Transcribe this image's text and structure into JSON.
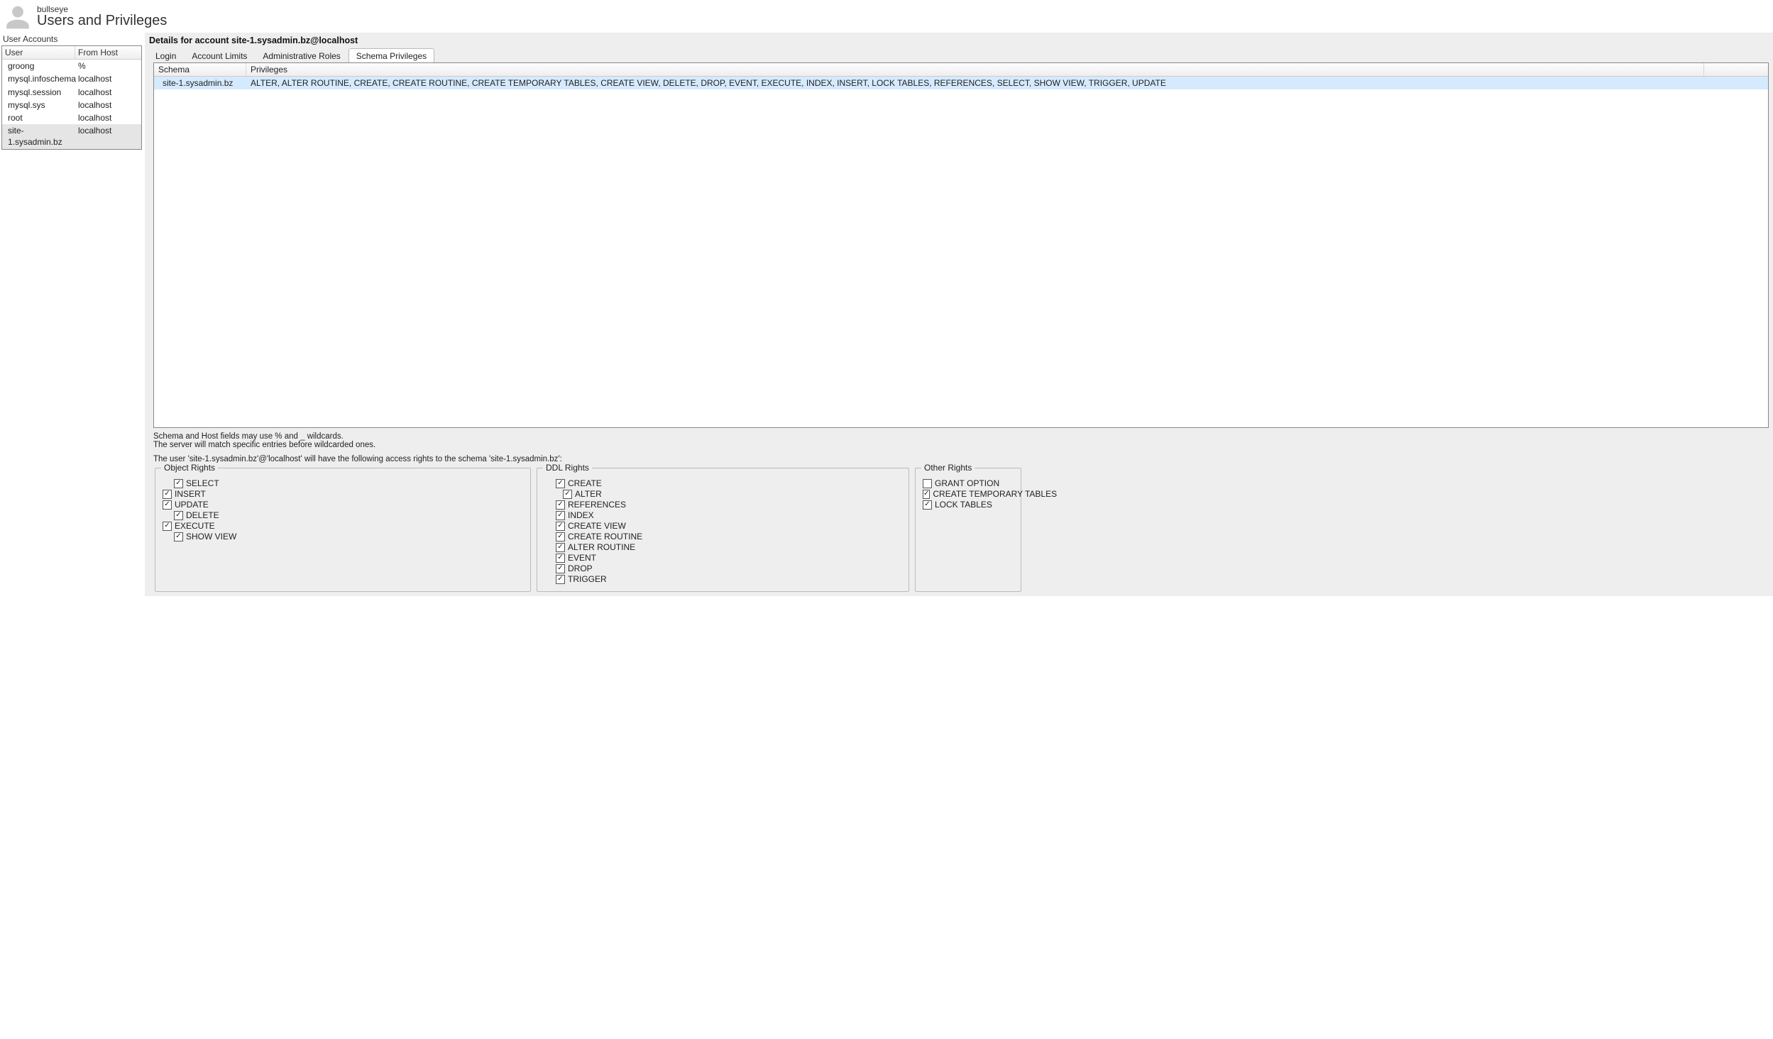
{
  "header": {
    "subtitle": "bullseye",
    "title": "Users and Privileges"
  },
  "left": {
    "section_label": "User Accounts",
    "columns": {
      "user": "User",
      "host": "From Host"
    },
    "rows": [
      {
        "user": "groong",
        "host": "%"
      },
      {
        "user": "mysql.infoschema",
        "host": "localhost"
      },
      {
        "user": "mysql.session",
        "host": "localhost"
      },
      {
        "user": "mysql.sys",
        "host": "localhost"
      },
      {
        "user": "root",
        "host": "localhost"
      },
      {
        "user": "site-1.sysadmin.bz",
        "host": "localhost"
      }
    ],
    "selected_index": 5
  },
  "details": {
    "title": "Details for account site-1.sysadmin.bz@localhost",
    "tabs": [
      {
        "id": "login",
        "label": "Login"
      },
      {
        "id": "limits",
        "label": "Account Limits"
      },
      {
        "id": "roles",
        "label": "Administrative Roles"
      },
      {
        "id": "schema",
        "label": "Schema Privileges"
      }
    ],
    "active_tab": "schema",
    "schema_table": {
      "columns": {
        "schema": "Schema",
        "privileges": "Privileges"
      },
      "rows": [
        {
          "schema": "site-1.sysadmin.bz",
          "privileges": "ALTER, ALTER ROUTINE, CREATE, CREATE ROUTINE, CREATE TEMPORARY TABLES, CREATE VIEW, DELETE, DROP, EVENT, EXECUTE, INDEX, INSERT, LOCK TABLES, REFERENCES, SELECT, SHOW VIEW, TRIGGER, UPDATE"
        }
      ],
      "selected_index": 0
    },
    "hint1_line1": "Schema and Host fields may use % and _ wildcards.",
    "hint1_line2": "The server will match specific entries before wildcarded ones.",
    "hint2": "The user 'site-1.sysadmin.bz'@'localhost' will have the following access rights to the schema 'site-1.sysadmin.bz':",
    "groups": {
      "object": {
        "legend": "Object Rights",
        "items": [
          {
            "label": "SELECT",
            "checked": true,
            "indent": 1
          },
          {
            "label": "INSERT",
            "checked": true,
            "indent": 0
          },
          {
            "label": "UPDATE",
            "checked": true,
            "indent": 0
          },
          {
            "label": "DELETE",
            "checked": true,
            "indent": 1
          },
          {
            "label": "EXECUTE",
            "checked": true,
            "indent": 0
          },
          {
            "label": "SHOW VIEW",
            "checked": true,
            "indent": 1
          }
        ]
      },
      "ddl": {
        "legend": "DDL Rights",
        "items": [
          {
            "label": "CREATE",
            "checked": true,
            "indent": 1
          },
          {
            "label": "ALTER",
            "checked": true,
            "indent": 2
          },
          {
            "label": "REFERENCES",
            "checked": true,
            "indent": 1
          },
          {
            "label": "INDEX",
            "checked": true,
            "indent": 1
          },
          {
            "label": "CREATE VIEW",
            "checked": true,
            "indent": 1
          },
          {
            "label": "CREATE ROUTINE",
            "checked": true,
            "indent": 1
          },
          {
            "label": "ALTER ROUTINE",
            "checked": true,
            "indent": 1
          },
          {
            "label": "EVENT",
            "checked": true,
            "indent": 1
          },
          {
            "label": "DROP",
            "checked": true,
            "indent": 1
          },
          {
            "label": "TRIGGER",
            "checked": true,
            "indent": 1
          }
        ]
      },
      "other": {
        "legend": "Other Rights",
        "items": [
          {
            "label": "GRANT OPTION",
            "checked": false,
            "indent": 0
          },
          {
            "label": "CREATE TEMPORARY TABLES",
            "checked": true,
            "indent": 0
          },
          {
            "label": "LOCK TABLES",
            "checked": true,
            "indent": 0
          }
        ]
      }
    }
  }
}
